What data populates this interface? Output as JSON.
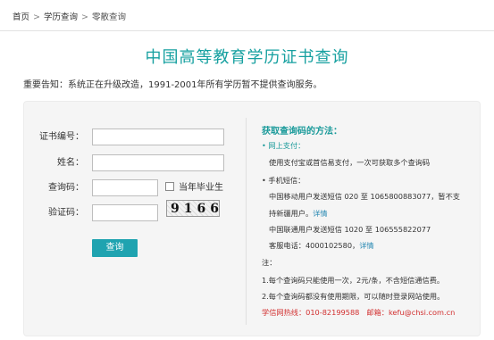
{
  "breadcrumb": {
    "home": "首页",
    "level2": "学历查询",
    "current": "零散查询",
    "separator": ">"
  },
  "page": {
    "title": "中国高等教育学历证书查询",
    "notice": "重要告知：系统正在升级改造，1991-2001年所有学历暂不提供查询服务。"
  },
  "form": {
    "cert_label": "证书编号：",
    "name_label": "姓名：",
    "code_label": "查询码：",
    "graduate_label": "当年毕业生",
    "captcha_label": "验证码：",
    "captcha_text": "9166",
    "submit_label": "查询"
  },
  "help": {
    "title": "获取查询码的方法：",
    "online_title": "• 网上支付：",
    "online_desc": "使用支付宝或首信易支付，一次可获取多个查询码",
    "sms_title": "• 手机短信：",
    "mobile_line1": "中国移动用户发送短信 020 至 1065800883077，暂不支",
    "mobile_line2": "持新疆用户。",
    "details_link": "详情",
    "unicom_line": "中国联通用户发送短信 1020 至 106555822077",
    "service_line": "客服电话：4000102580，",
    "note_title": "注：",
    "note1": "1.每个查询码只能使用一次，2元/条，不含短信通信费。",
    "note2": "2.每个查询码都没有使用期限，可以随时登录网站使用。",
    "hotline": "学信网热线：010-82199588",
    "email": "邮箱：kefu@chsi.com.cn"
  },
  "colors": {
    "accent": "#16a0a0",
    "button": "#1fa3b0",
    "link": "#2a8ab4",
    "hotline": "#d23030"
  }
}
